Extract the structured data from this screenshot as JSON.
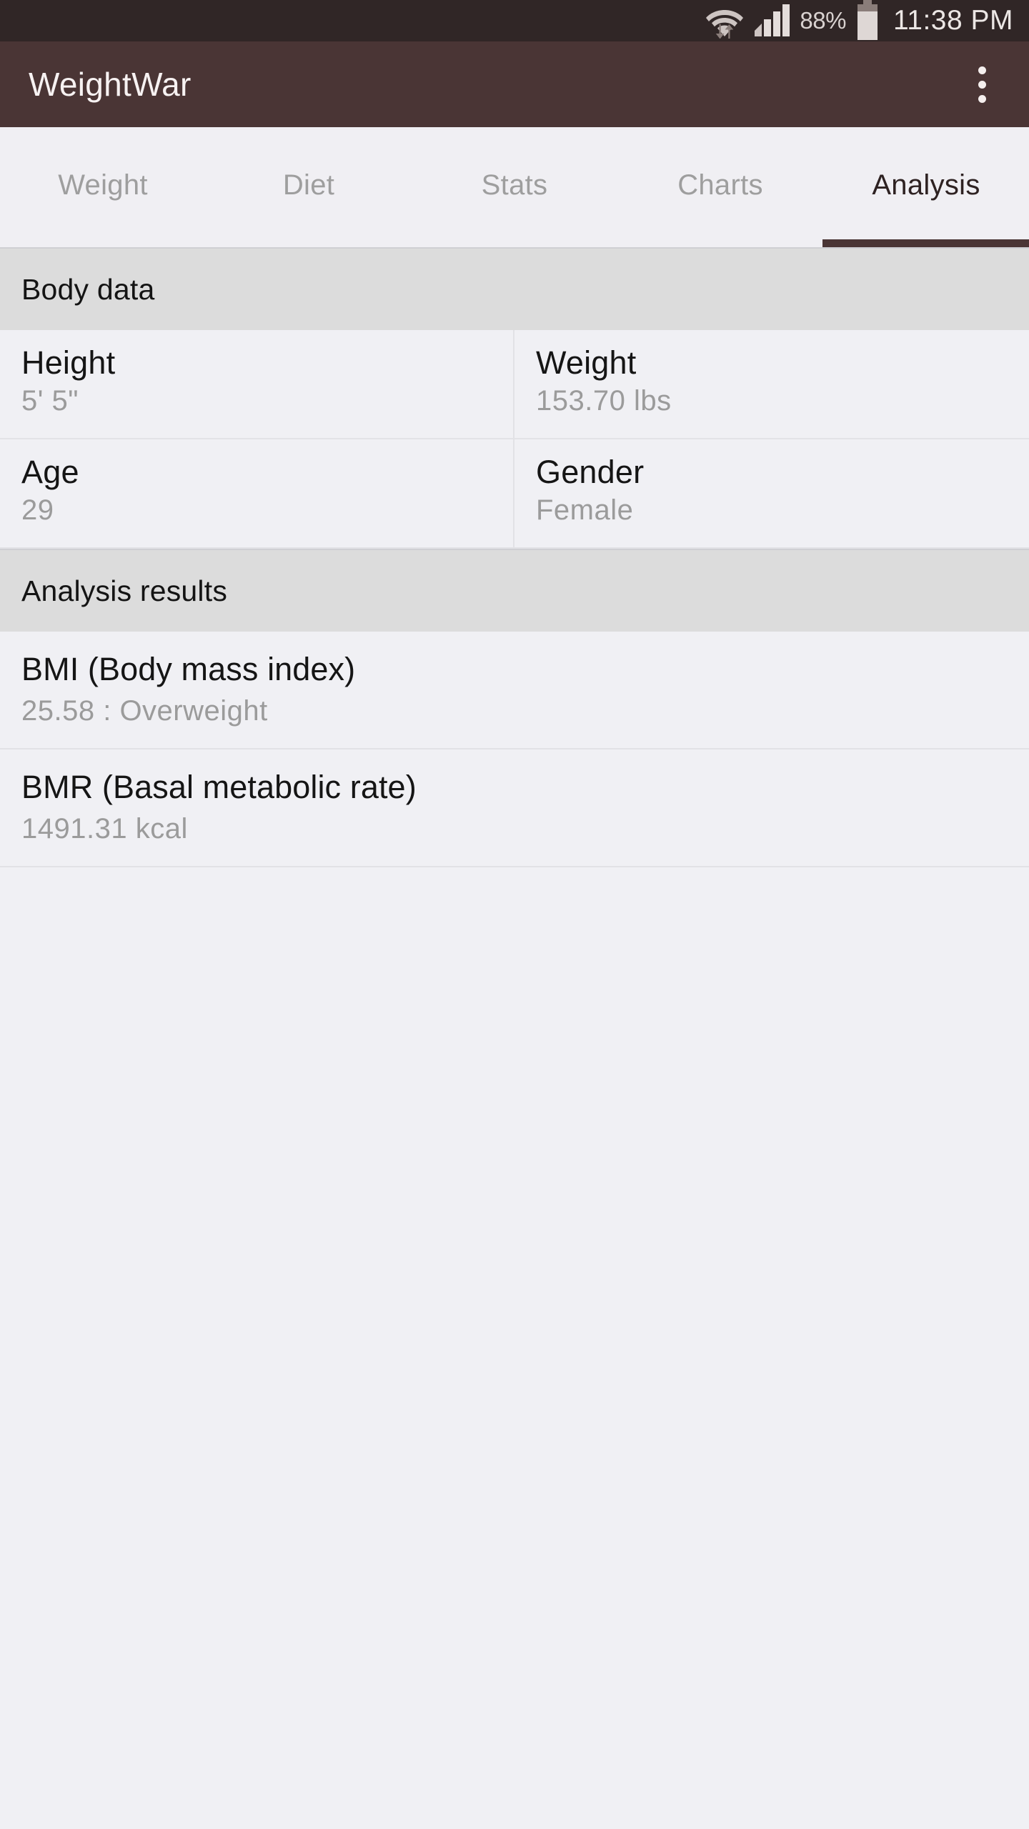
{
  "status_bar": {
    "wifi_icon": "wifi-with-transfer-arrows-icon",
    "signal_icon": "cellular-signal-4-bars-icon",
    "battery_percent": "88%",
    "battery_icon": "battery-icon",
    "time": "11:38 PM"
  },
  "app_bar": {
    "title": "WeightWar",
    "overflow_icon": "overflow-menu-icon"
  },
  "tabs": [
    {
      "label": "Weight",
      "active": false
    },
    {
      "label": "Diet",
      "active": false
    },
    {
      "label": "Stats",
      "active": false
    },
    {
      "label": "Charts",
      "active": false
    },
    {
      "label": "Analysis",
      "active": true
    }
  ],
  "sections": {
    "body_data": {
      "header": "Body data",
      "rows": [
        [
          {
            "label": "Height",
            "value": "5' 5\""
          },
          {
            "label": "Weight",
            "value": "153.70 lbs"
          }
        ],
        [
          {
            "label": "Age",
            "value": "29"
          },
          {
            "label": "Gender",
            "value": "Female"
          }
        ]
      ]
    },
    "analysis_results": {
      "header": "Analysis results",
      "items": [
        {
          "label": "BMI (Body mass index)",
          "value": "25.58 : Overweight"
        },
        {
          "label": "BMR (Basal metabolic rate)",
          "value": "1491.31 kcal"
        }
      ]
    }
  },
  "colors": {
    "status_bar": "#302626",
    "app_bar": "#4a3535",
    "accent": "#4a3535",
    "section_header_bg": "#dcdcdc",
    "content_bg": "#f0f0f4",
    "tab_bar_bg": "#f0eff3",
    "primary_text": "#151515",
    "secondary_text": "#9b9b9b",
    "inactive_tab_text": "#9e9e9e"
  }
}
